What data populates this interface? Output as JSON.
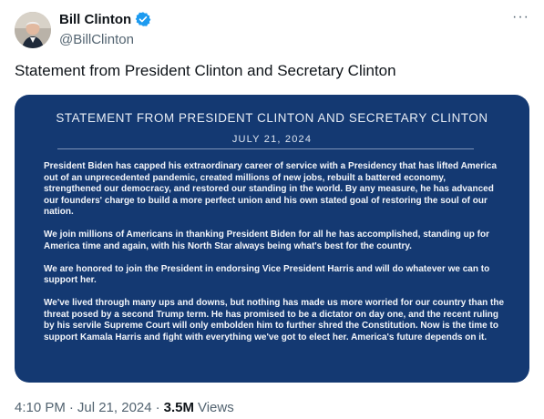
{
  "author": {
    "name": "Bill Clinton",
    "handle": "@BillClinton",
    "verified_color": "#1d9bf0"
  },
  "more_icon": "···",
  "tweet": {
    "text": "Statement from President Clinton and Secretary Clinton"
  },
  "statement": {
    "title": "STATEMENT FROM PRESIDENT CLINTON AND SECRETARY CLINTON",
    "date": "JULY 21, 2024",
    "background_color": "#143972",
    "paragraphs": [
      "President Biden has capped his extraordinary career of service with a Presidency that has lifted America out of an unprecedented pandemic, created millions of new jobs, rebuilt a battered economy, strengthened our democracy, and restored our standing in the world. By any measure, he has advanced our founders' charge to build a more perfect union and his own stated goal of restoring the soul of our nation.",
      "We join millions of Americans in thanking President Biden for all he has accomplished, standing up for America time and again, with his North Star always being what's best for the country.",
      "We are honored to join the President in endorsing Vice President Harris and will do whatever we can to support her.",
      "We've lived through many ups and downs, but nothing has made us more worried for our country than the threat posed by a second Trump term. He has promised to be a dictator on day one, and the recent ruling by his servile Supreme Court will only embolden him to further shred the Constitution. Now is the time to support Kamala Harris and fight with everything we've got to elect her. America's future depends on it."
    ]
  },
  "meta": {
    "time": "4:10 PM",
    "separator": "·",
    "date": "Jul 21, 2024",
    "separator2": "·",
    "views_count": "3.5M",
    "views_label": "Views"
  }
}
